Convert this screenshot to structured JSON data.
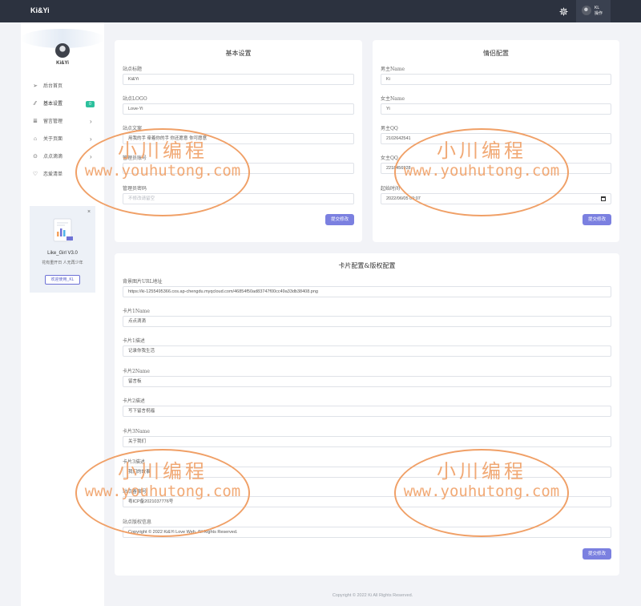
{
  "app": {
    "brand": "Ki&Yi"
  },
  "user": {
    "name": "KL",
    "role": "操作"
  },
  "sidebar": {
    "profile_name": "Ki&Yi",
    "items": [
      {
        "label": "后台首页",
        "icon": "send-icon"
      },
      {
        "label": "基本设置",
        "icon": "code-icon",
        "badge": "0"
      },
      {
        "label": "留言管理",
        "icon": "list-icon"
      },
      {
        "label": "关于页面",
        "icon": "tag-icon"
      },
      {
        "label": "点点滴滴",
        "icon": "map-pin-icon"
      },
      {
        "label": "恋爱清单",
        "icon": "heart-icon"
      }
    ],
    "promo": {
      "title": "Like_Girl V3.0",
      "subtitle": "花有重开日 人无再少年",
      "button": "欢迎使用_KL"
    }
  },
  "basic": {
    "title": "基本设置",
    "fields": [
      {
        "label": "站点标题",
        "value": "Ki&Yi",
        "placeholder": ""
      },
      {
        "label": "站点LOGO",
        "value": "Love-Yi",
        "placeholder": ""
      },
      {
        "label": "站点文案",
        "value": "用我的手 牵着你的手 你还愿意 你可愿意",
        "placeholder": ""
      },
      {
        "label": "管理员账号",
        "value": "",
        "placeholder": ""
      },
      {
        "label": "管理员密码",
        "value": "",
        "placeholder": "不修改请留空"
      }
    ],
    "submit": "提交修改"
  },
  "lovers": {
    "title": "情侣配置",
    "fields": [
      {
        "label": "男主Name",
        "value": "Ki"
      },
      {
        "label": "女主Name",
        "value": "Yi"
      },
      {
        "label": "男主QQ",
        "value": "2102642541"
      },
      {
        "label": "女主QQ",
        "value": "2218456928"
      },
      {
        "label": "起始时间",
        "value": "2022/06/05 00:07"
      }
    ],
    "submit": "提交修改"
  },
  "cards": {
    "title": "卡片配置&版权配置",
    "fields": [
      {
        "label": "背景图片URL地址",
        "value": "https://ki-1255495366.cos.ap-chengdu.myqcloud.com/46854f50ad83747f00cc49a33db38408.png"
      },
      {
        "label": "卡片1Name",
        "value": "点点滴滴"
      },
      {
        "label": "卡片1描述",
        "value": "记录你我生活"
      },
      {
        "label": "卡片2Name",
        "value": "留言板"
      },
      {
        "label": "卡片2描述",
        "value": "写下留言祝福"
      },
      {
        "label": "卡片3Name",
        "value": "关于我们"
      },
      {
        "label": "卡片3描述",
        "value": "我们的故事"
      },
      {
        "label": "站点备案号",
        "value": "粤ICP备2021037776号"
      },
      {
        "label": "站点版权信息",
        "value": "Copyright © 2022 Ki&Yi Love Web. All Rights Reserved."
      }
    ],
    "submit": "提交修改"
  },
  "footer": {
    "text": "Copyright © 2022 Ki All Rights Reserved."
  },
  "watermark": {
    "cn": "小川编程",
    "url": "www.youhutong.com"
  },
  "colors": {
    "topbar": "#2c323f",
    "accent": "#7b80e0",
    "badge": "#2cc09d",
    "watermark": "#f0a067"
  }
}
